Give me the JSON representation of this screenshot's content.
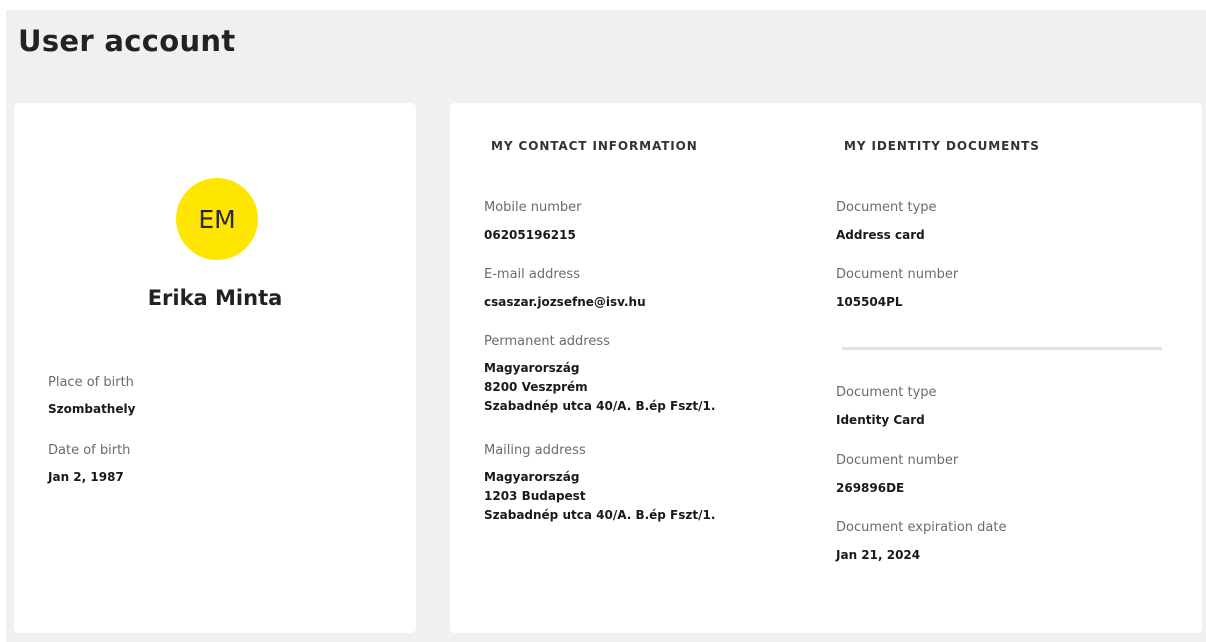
{
  "page": {
    "title": "User account"
  },
  "profile": {
    "initials": "EM",
    "avatar_color": "#ffe600",
    "name": "Erika Minta",
    "place_of_birth_label": "Place of birth",
    "place_of_birth": "Szombathely",
    "date_of_birth_label": "Date of birth",
    "date_of_birth": "Jan 2, 1987"
  },
  "contact": {
    "section_title": "MY CONTACT INFORMATION",
    "mobile_label": "Mobile number",
    "mobile": "06205196215",
    "email_label": "E-mail address",
    "email": "csaszar.jozsefne@isv.hu",
    "permanent_label": "Permanent address",
    "permanent_address": [
      "Magyarország",
      "8200 Veszprém",
      "Szabadnép utca 40/A. B.ép Fszt/1."
    ],
    "mailing_label": "Mailing address",
    "mailing_address": [
      "Magyarország",
      "1203 Budapest",
      "Szabadnép utca 40/A. B.ép Fszt/1."
    ]
  },
  "identity": {
    "section_title": "MY IDENTITY DOCUMENTS",
    "documents": [
      {
        "type_label": "Document type",
        "type": "Address card",
        "number_label": "Document number",
        "number": "105504PL"
      },
      {
        "type_label": "Document type",
        "type": "Identity Card",
        "number_label": "Document number",
        "number": "269896DE",
        "expiration_label": "Document expiration date",
        "expiration": "Jan 21, 2024"
      }
    ]
  }
}
